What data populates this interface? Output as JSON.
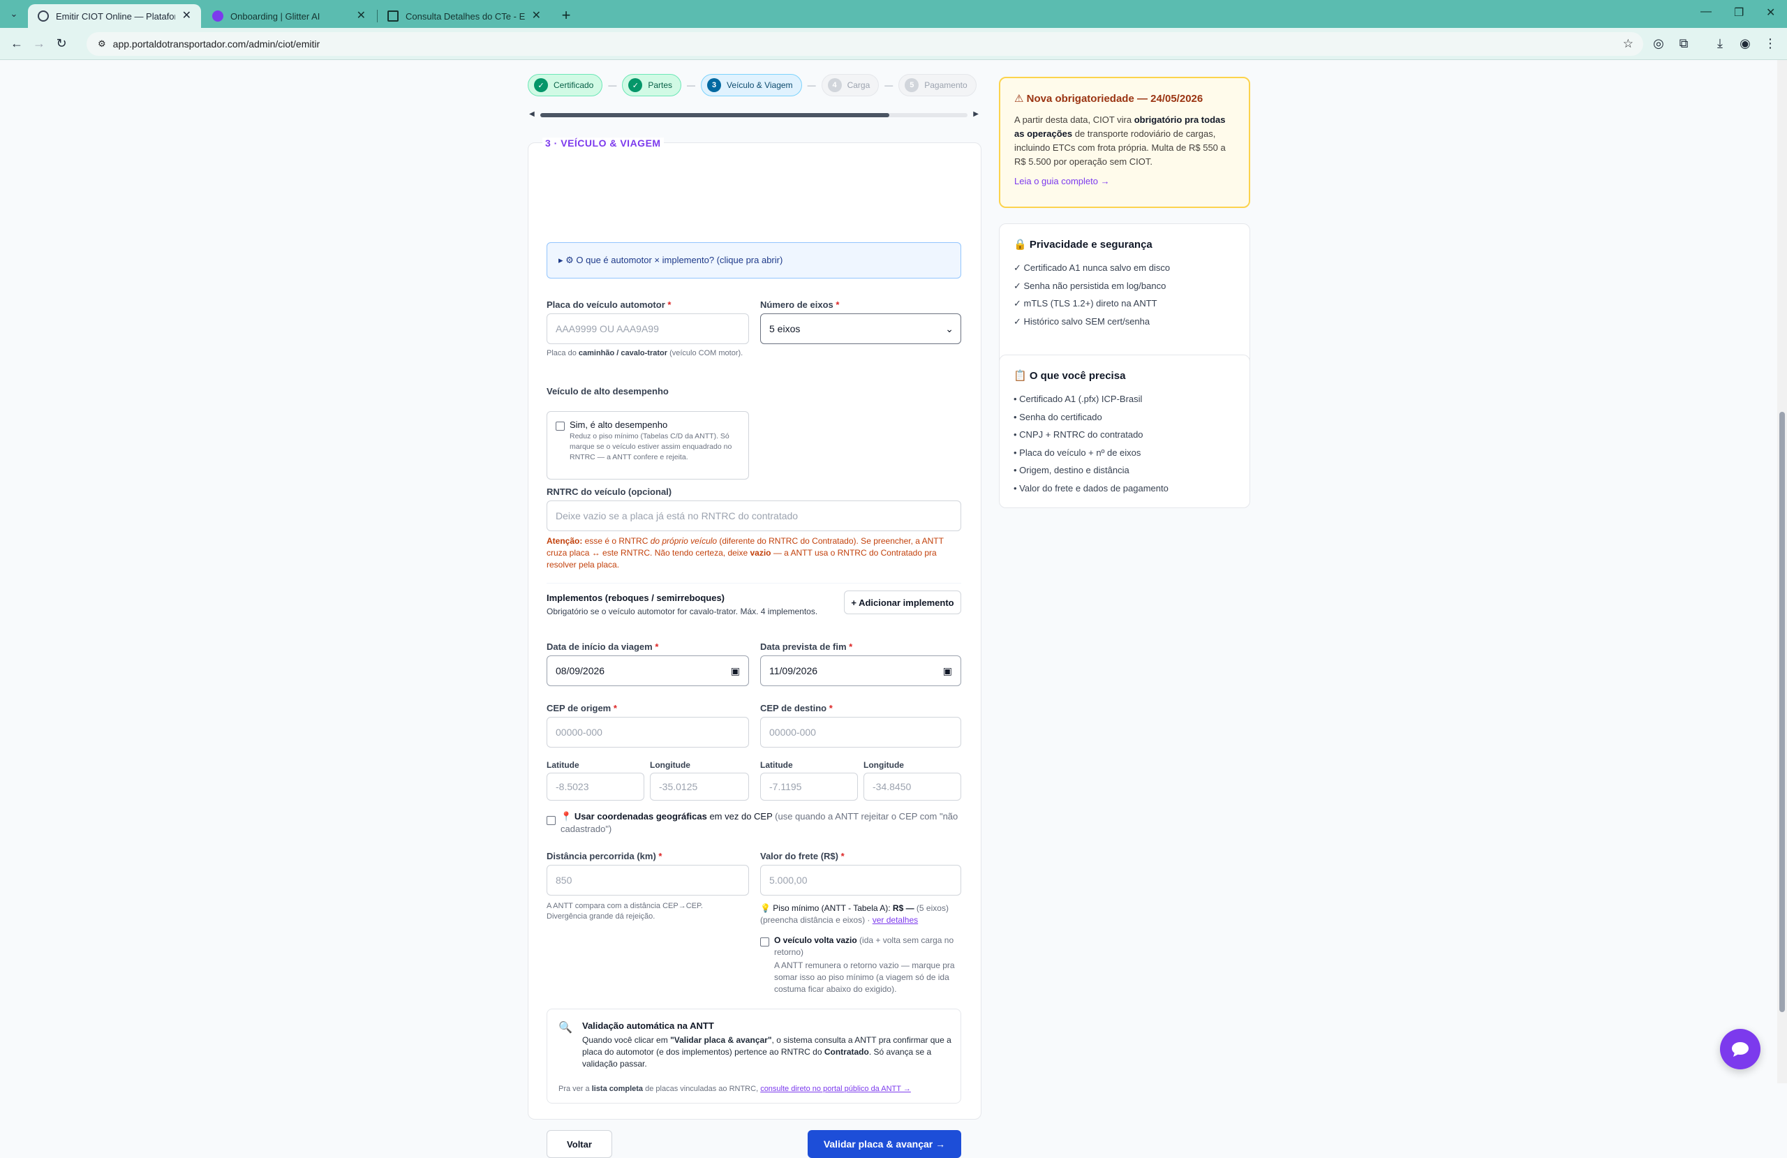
{
  "browser": {
    "tabs": [
      {
        "title": "Emitir CIOT Online — Plataforma",
        "active": true
      },
      {
        "title": "Onboarding | Glitter AI",
        "active": false
      },
      {
        "title": "Consulta Detalhes do CTe - ERP",
        "active": false
      }
    ],
    "url": "app.portaldotransportador.com/admin/ciot/emitir"
  },
  "steps": [
    {
      "num": "✓",
      "label": "Certificado",
      "state": "done"
    },
    {
      "num": "✓",
      "label": "Partes",
      "state": "done"
    },
    {
      "num": "3",
      "label": "Veículo & Viagem",
      "state": "current"
    },
    {
      "num": "4",
      "label": "Carga",
      "state": "todo"
    },
    {
      "num": "5",
      "label": "Pagamento",
      "state": "todo"
    }
  ],
  "form": {
    "section_title": "3 · VEÍCULO & VIAGEM",
    "info_toggle": "▸ ⚙ O que é automotor × implemento? (clique pra abrir)",
    "placa_label": "Placa do veículo automotor",
    "placa_placeholder": "AAA9999 OU AAA9A99",
    "placa_hint_a": "Placa do ",
    "placa_hint_b": "caminhão / cavalo-trator",
    "placa_hint_c": " (veículo COM motor).",
    "eixos_label": "Número de eixos",
    "eixos_value": "5 eixos",
    "alto_label": "Veículo de alto desempenho",
    "alto_check": "Sim, é alto desempenho",
    "alto_desc": "Reduz o piso mínimo (Tabelas C/D da ANTT). Só marque se o veículo estiver assim enquadrado no RNTRC — a ANTT confere e rejeita.",
    "rntrc_label": "RNTRC do veículo (opcional)",
    "rntrc_placeholder": "Deixe vazio se a placa já está no RNTRC do contratado",
    "rntrc_warn_1": "Atenção:",
    "rntrc_warn_2": " esse é o RNTRC ",
    "rntrc_warn_3": "do próprio veículo",
    "rntrc_warn_4": " (diferente do RNTRC do Contratado). Se preencher, a ANTT cruza placa ↔ este RNTRC. Não tendo certeza, deixe ",
    "rntrc_warn_5": "vazio",
    "rntrc_warn_6": " — a ANTT usa o RNTRC do Contratado pra resolver pela placa.",
    "impl_title": "Implementos (reboques / semirreboques)",
    "impl_desc": "Obrigatório se o veículo automotor for cavalo-trator. Máx. 4 implementos.",
    "impl_button": "+ Adicionar implemento",
    "inicio_label": "Data de início da viagem",
    "inicio_value": "08/09/2026",
    "fim_label": "Data prevista de fim",
    "fim_value": "11/09/2026",
    "cep_origem_label": "CEP de origem",
    "cep_origem_placeholder": "00000-000",
    "cep_destino_label": "CEP de destino",
    "cep_destino_placeholder": "00000-000",
    "lat_label": "Latitude",
    "lon_label": "Longitude",
    "lat_origem": "-8.5023",
    "lon_origem": "-35.0125",
    "lat_destino": "-7.1195",
    "lon_destino": "-34.8450",
    "geo_icon": "📍",
    "geo_bold": "Usar coordenadas geográficas",
    "geo_text": " em vez do CEP ",
    "geo_grey": "(use quando a ANTT rejeitar o CEP com \"não cadastrado\")",
    "dist_label": "Distância percorrida (km)",
    "dist_placeholder": "850",
    "dist_hint": "A ANTT compara com a distância CEP→CEP. Divergência grande dá rejeição.",
    "frete_label": "Valor do frete (R$)",
    "frete_placeholder": "5.000,00",
    "piso_icon": "💡",
    "piso_text": "Piso mínimo (ANTT - Tabela A): ",
    "piso_value": "R$ —",
    "piso_eixos": " (5 eixos)",
    "piso_fill": "(preencha distância e eixos) · ",
    "piso_link": "ver detalhes",
    "vazio_bold": "O veículo volta vazio",
    "vazio_grey": " (ida + volta sem carga no retorno)",
    "vazio_desc": "A ANTT remunera o retorno vazio — marque pra somar isso ao piso mínimo (a viagem só de ida costuma ficar abaixo do exigido).",
    "antt_icon": "🔍",
    "antt_title": "Validação automática na ANTT",
    "antt_1": "Quando você clicar em ",
    "antt_2": "\"Validar placa & avançar\"",
    "antt_3": ", o sistema consulta a ANTT pra confirmar que a placa do automotor (e dos implementos) pertence ao RNTRC do ",
    "antt_4": "Contratado",
    "antt_5": ". Só avança se a validação passar.",
    "antt_list_1": "Pra ver a ",
    "antt_list_2": "lista completa",
    "antt_list_3": " de placas vinculadas ao RNTRC, ",
    "antt_list_link": "consulte direto no portal público da ANTT →",
    "back_button": "Voltar",
    "next_button": "Validar placa & avançar →"
  },
  "sidebar": {
    "notice_title": "⚠ Nova obrigatoriedade — 24/05/2026",
    "notice_1": "A partir desta data, CIOT vira ",
    "notice_2": "obrigatório pra todas as operações",
    "notice_3": " de transporte rodoviário de cargas, incluindo ETCs com frota própria. Multa de R$ 550 a R$ 5.500 por operação sem CIOT.",
    "notice_link": "Leia o guia completo →",
    "privacy_title": "🔒 Privacidade e segurança",
    "privacy_items": [
      "✓ Certificado A1 nunca salvo em disco",
      "✓ Senha não persistida em log/banco",
      "✓ mTLS (TLS 1.2+) direto na ANTT",
      "✓ Histórico salvo SEM cert/senha"
    ],
    "needs_title": "📋 O que você precisa",
    "needs_items": [
      "• Certificado A1 (.pfx) ICP-Brasil",
      "• Senha do certificado",
      "• CNPJ + RNTRC do contratado",
      "• Placa do veículo + nº de eixos",
      "• Origem, destino e distância",
      "• Valor do frete e dados de pagamento"
    ]
  },
  "colors": {
    "accent": "#7c3aed",
    "primary": "#1d4ed8",
    "warning": "#c2410c",
    "tabbar": "#5bbcb0"
  }
}
